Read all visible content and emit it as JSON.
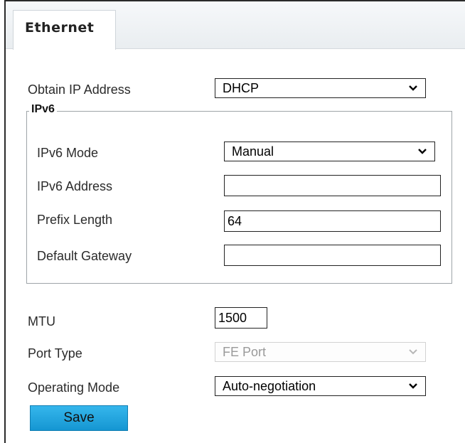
{
  "tab": {
    "label": "Ethernet"
  },
  "obtain_ip": {
    "label": "Obtain IP Address",
    "value": "DHCP"
  },
  "ipv6": {
    "legend": "IPv6",
    "mode": {
      "label": "IPv6 Mode",
      "value": "Manual"
    },
    "address": {
      "label": "IPv6 Address",
      "value": ""
    },
    "prefix_length": {
      "label": "Prefix Length",
      "value": "64"
    },
    "gateway": {
      "label": "Default Gateway",
      "value": ""
    }
  },
  "mtu": {
    "label": "MTU",
    "value": "1500"
  },
  "port_type": {
    "label": "Port Type",
    "value": "FE Port",
    "disabled": true
  },
  "operating_mode": {
    "label": "Operating Mode",
    "value": "Auto-negotiation"
  },
  "save": {
    "label": "Save"
  },
  "colors": {
    "save_button": "#1fa3de",
    "tab_bar": "#e9edf0",
    "disabled_text": "#9a9a9a"
  }
}
